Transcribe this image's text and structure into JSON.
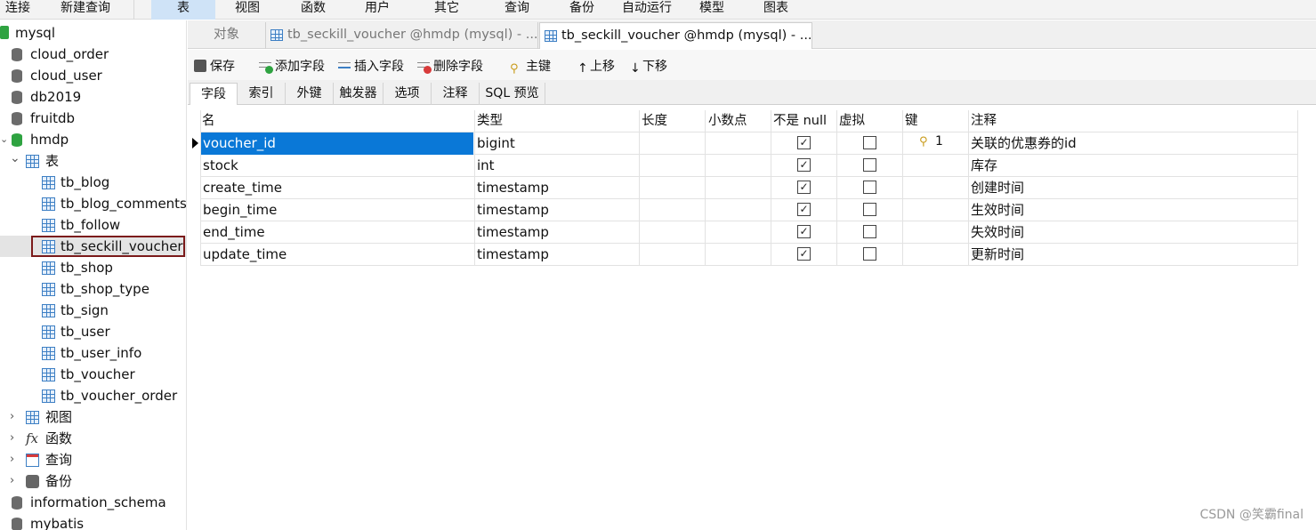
{
  "menu": {
    "items": [
      {
        "label": "连接",
        "active": false
      },
      {
        "label": "新建查询",
        "active": false
      },
      {
        "label": "表",
        "active": true
      },
      {
        "label": "视图",
        "active": false
      },
      {
        "label": "函数",
        "active": false
      },
      {
        "label": "用户",
        "active": false
      },
      {
        "label": "其它",
        "active": false
      },
      {
        "label": "查询",
        "active": false
      },
      {
        "label": "备份",
        "active": false
      },
      {
        "label": "自动运行",
        "active": false
      },
      {
        "label": "模型",
        "active": false
      },
      {
        "label": "图表",
        "active": false
      }
    ]
  },
  "tree": {
    "connection": "mysql",
    "databases": [
      "cloud_order",
      "cloud_user",
      "db2019",
      "fruitdb"
    ],
    "open_db": "hmdp",
    "tables_group": "表",
    "tables": [
      "tb_blog",
      "tb_blog_comments",
      "tb_follow",
      "tb_seckill_voucher",
      "tb_shop",
      "tb_shop_type",
      "tb_sign",
      "tb_user",
      "tb_user_info",
      "tb_voucher",
      "tb_voucher_order"
    ],
    "selected_table": "tb_seckill_voucher",
    "groups": [
      {
        "label": "视图",
        "icon": "view-icon"
      },
      {
        "label": "函数",
        "icon": "function-icon"
      },
      {
        "label": "查询",
        "icon": "query-icon"
      },
      {
        "label": "备份",
        "icon": "backup-icon"
      }
    ],
    "other_dbs": [
      "information_schema",
      "mybatis"
    ]
  },
  "doc_tabs": {
    "objects": "对象",
    "tab1": "tb_seckill_voucher @hmdp (mysql) - ...",
    "tab2": "tb_seckill_voucher @hmdp (mysql) - ..."
  },
  "actions": {
    "save": "保存",
    "add_field": "添加字段",
    "insert_field": "插入字段",
    "delete_field": "删除字段",
    "primary_key": "主键",
    "move_up": "上移",
    "move_down": "下移"
  },
  "sub_tabs": [
    "字段",
    "索引",
    "外键",
    "触发器",
    "选项",
    "注释",
    "SQL 预览"
  ],
  "grid": {
    "headers": {
      "name": "名",
      "type": "类型",
      "length": "长度",
      "decimals": "小数点",
      "not_null": "不是 null",
      "virtual": "虚拟",
      "key": "键",
      "comment": "注释"
    },
    "rows": [
      {
        "name": "voucher_id",
        "type": "bigint",
        "not_null": true,
        "virtual": false,
        "key": "1",
        "comment": "关联的优惠券的id"
      },
      {
        "name": "stock",
        "type": "int",
        "not_null": true,
        "virtual": false,
        "key": "",
        "comment": "库存"
      },
      {
        "name": "create_time",
        "type": "timestamp",
        "not_null": true,
        "virtual": false,
        "key": "",
        "comment": "创建时间"
      },
      {
        "name": "begin_time",
        "type": "timestamp",
        "not_null": true,
        "virtual": false,
        "key": "",
        "comment": "生效时间"
      },
      {
        "name": "end_time",
        "type": "timestamp",
        "not_null": true,
        "virtual": false,
        "key": "",
        "comment": "失效时间"
      },
      {
        "name": "update_time",
        "type": "timestamp",
        "not_null": true,
        "virtual": false,
        "key": "",
        "comment": "更新时间"
      }
    ]
  },
  "watermark": "CSDN @笑霸final"
}
